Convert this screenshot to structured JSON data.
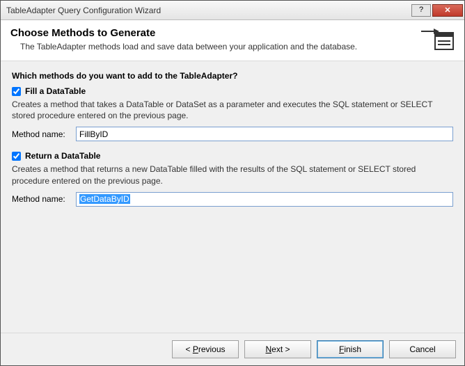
{
  "window": {
    "title": "TableAdapter Query Configuration Wizard"
  },
  "header": {
    "title": "Choose Methods to Generate",
    "subtitle": "The TableAdapter methods load and save data between your application and the database."
  },
  "main": {
    "prompt": "Which methods do you want to add to the TableAdapter?",
    "fill": {
      "checked": true,
      "label": "Fill a DataTable",
      "desc": "Creates a method that takes a DataTable or DataSet as a parameter and executes the SQL statement or SELECT stored procedure entered on the previous page.",
      "name_label": "Method name:",
      "name_value": "FillByID"
    },
    "return": {
      "checked": true,
      "label": "Return a DataTable",
      "desc": "Creates a method that returns a new DataTable filled with the results of the SQL statement or SELECT stored procedure entered on the previous page.",
      "name_label": "Method name:",
      "name_value": "GetDataByID"
    }
  },
  "footer": {
    "previous": "< Previous",
    "next": "Next >",
    "finish": "Finish",
    "cancel": "Cancel"
  }
}
